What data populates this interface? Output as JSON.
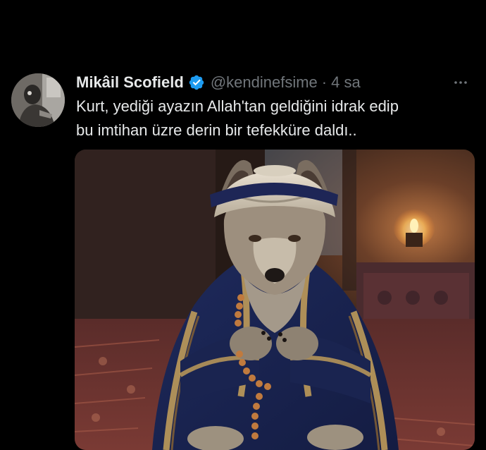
{
  "tweet": {
    "author": {
      "display_name": "Mikâil Scofield",
      "handle": "@kendinefsime",
      "verified_icon": "verified-badge-icon",
      "avatar_icon": "avatar-photo"
    },
    "separator": "·",
    "time": "4 sa",
    "more_icon": "more-options-icon",
    "text_lines": [
      "Kurt, yediği ayazın Allah'tan geldiğini idrak edip",
      "bu imtihan üzre derin bir tefekküre daldı.."
    ],
    "media": {
      "image_icon": "wolf-in-turban-photo"
    }
  },
  "colors": {
    "background": "#000000",
    "text_primary": "#e7e9ea",
    "text_secondary": "#71767b",
    "verified_blue": "#1d9bf0"
  }
}
